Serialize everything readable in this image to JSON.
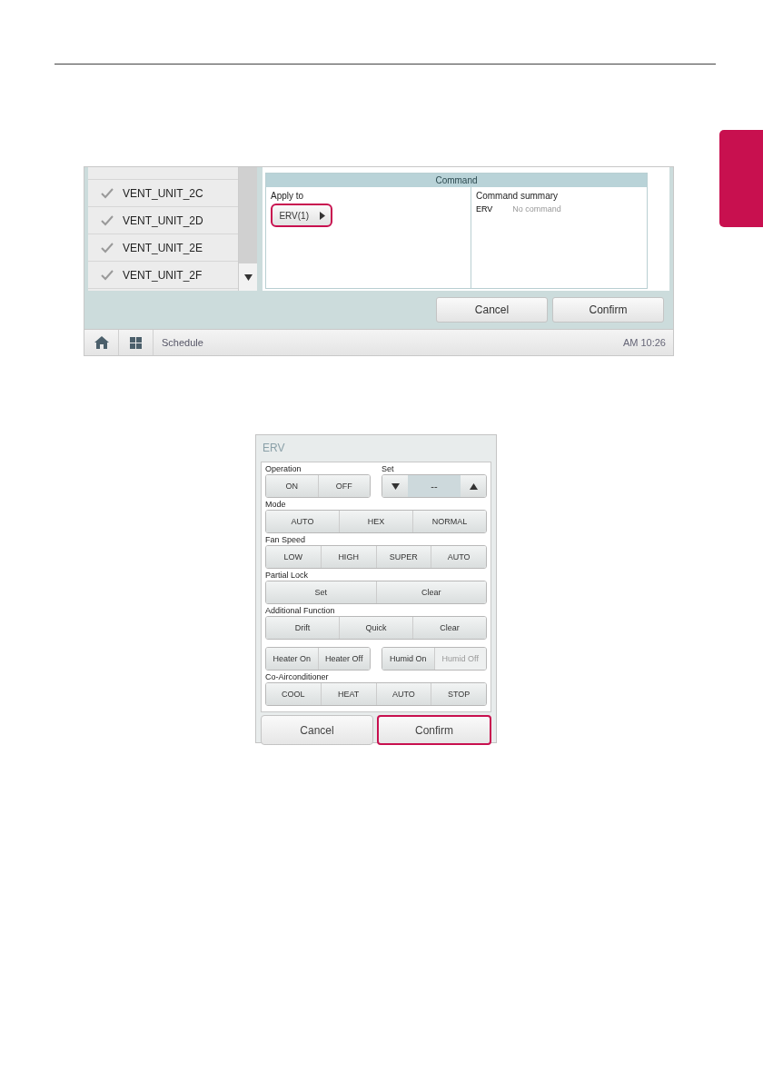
{
  "schedule_screen": {
    "device_list": [
      {
        "name": "VENT_UNIT_2C",
        "checked": true
      },
      {
        "name": "VENT_UNIT_2D",
        "checked": true
      },
      {
        "name": "VENT_UNIT_2E",
        "checked": true
      },
      {
        "name": "VENT_UNIT_2F",
        "checked": true
      }
    ],
    "command_panel": {
      "title": "Command",
      "apply_to_label": "Apply to",
      "apply_button": {
        "label": "ERV(1)",
        "highlighted": true
      },
      "summary_title": "Command summary",
      "summary_rows": [
        {
          "device": "ERV",
          "command": "No command"
        }
      ]
    },
    "buttons": [
      {
        "label": "Cancel",
        "highlighted": false
      },
      {
        "label": "Confirm",
        "highlighted": false
      }
    ],
    "taskbar": {
      "title": "Schedule",
      "time": "AM 10:26"
    }
  },
  "erv_dialog": {
    "title": "ERV",
    "rows": [
      {
        "groups": [
          {
            "label": "Operation",
            "kind": "buttons",
            "buttons": [
              {
                "label": "ON",
                "disabled": false
              },
              {
                "label": "OFF",
                "disabled": false
              }
            ]
          },
          {
            "label": "Set",
            "kind": "stepper",
            "value": "--"
          }
        ]
      },
      {
        "groups": [
          {
            "label": "Mode",
            "kind": "buttons",
            "buttons": [
              {
                "label": "AUTO",
                "disabled": false
              },
              {
                "label": "HEX",
                "disabled": false
              },
              {
                "label": "NORMAL",
                "disabled": false
              }
            ]
          }
        ]
      },
      {
        "groups": [
          {
            "label": "Fan Speed",
            "kind": "buttons",
            "buttons": [
              {
                "label": "LOW",
                "disabled": false
              },
              {
                "label": "HIGH",
                "disabled": false
              },
              {
                "label": "SUPER",
                "disabled": false
              },
              {
                "label": "AUTO",
                "disabled": false
              }
            ]
          }
        ]
      },
      {
        "groups": [
          {
            "label": "Partial Lock",
            "kind": "buttons",
            "buttons": [
              {
                "label": "Set",
                "disabled": false
              },
              {
                "label": "Clear",
                "disabled": false
              }
            ]
          }
        ]
      },
      {
        "groups": [
          {
            "label": "Additional Function",
            "kind": "buttons",
            "buttons": [
              {
                "label": "Drift",
                "disabled": false
              },
              {
                "label": "Quick",
                "disabled": false
              },
              {
                "label": "Clear",
                "disabled": false
              }
            ]
          }
        ]
      },
      {
        "groups": [
          {
            "kind": "buttons",
            "buttons": [
              {
                "label": "Heater On",
                "disabled": false
              },
              {
                "label": "Heater Off",
                "disabled": false
              }
            ]
          },
          {
            "kind": "buttons",
            "buttons": [
              {
                "label": "Humid On",
                "disabled": false
              },
              {
                "label": "Humid Off",
                "disabled": true
              }
            ]
          }
        ]
      },
      {
        "groups": [
          {
            "label": "Co-Airconditioner",
            "kind": "buttons",
            "buttons": [
              {
                "label": "COOL",
                "disabled": false
              },
              {
                "label": "HEAT",
                "disabled": false
              },
              {
                "label": "AUTO",
                "disabled": false
              },
              {
                "label": "STOP",
                "disabled": false
              }
            ]
          }
        ]
      }
    ],
    "buttons": [
      {
        "label": "Cancel",
        "highlighted": false
      },
      {
        "label": "Confirm",
        "highlighted": true
      }
    ]
  }
}
